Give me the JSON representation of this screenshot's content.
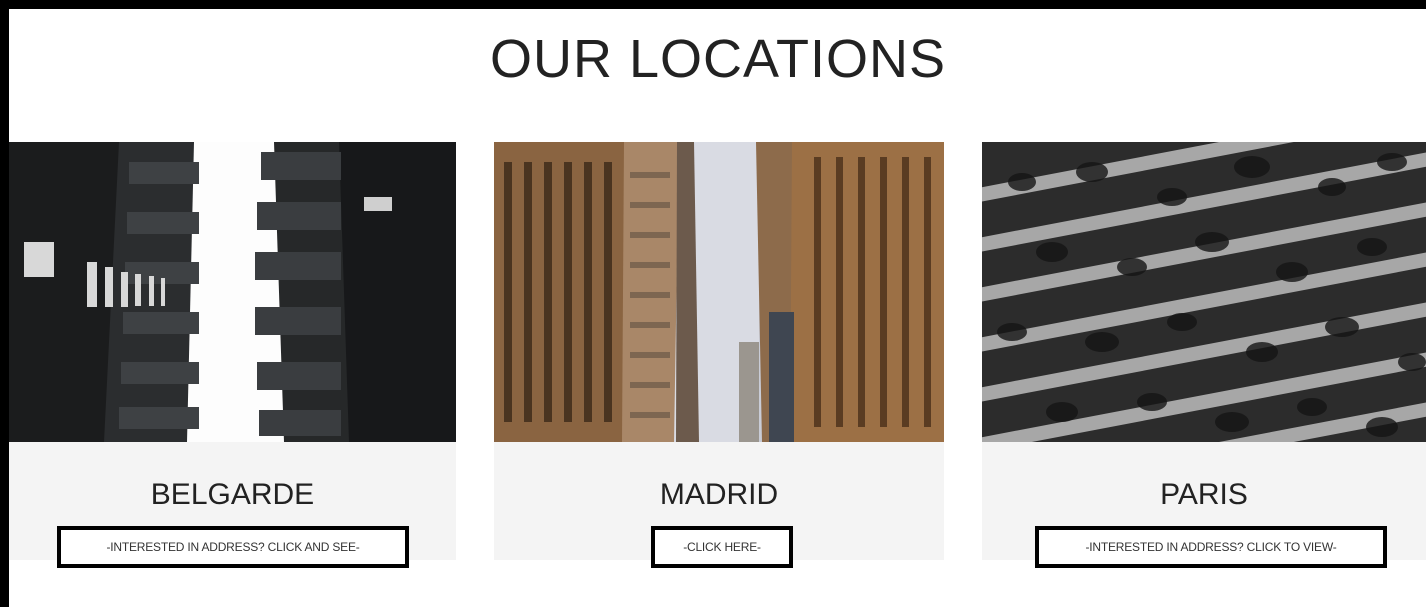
{
  "section": {
    "title": "OUR LOCATIONS"
  },
  "locations": [
    {
      "name": "BELGARDE",
      "link_text": "-INTERESTED IN ADDRESS? CLICK AND SEE-"
    },
    {
      "name": "MADRID",
      "link_text": "-CLICK HERE-"
    },
    {
      "name": "PARIS",
      "link_text": "-INTERESTED IN ADDRESS? CLICK TO VIEW-"
    }
  ],
  "colors": {
    "card_background": "#f4f4f4",
    "border": "#000000",
    "text": "#222222"
  }
}
